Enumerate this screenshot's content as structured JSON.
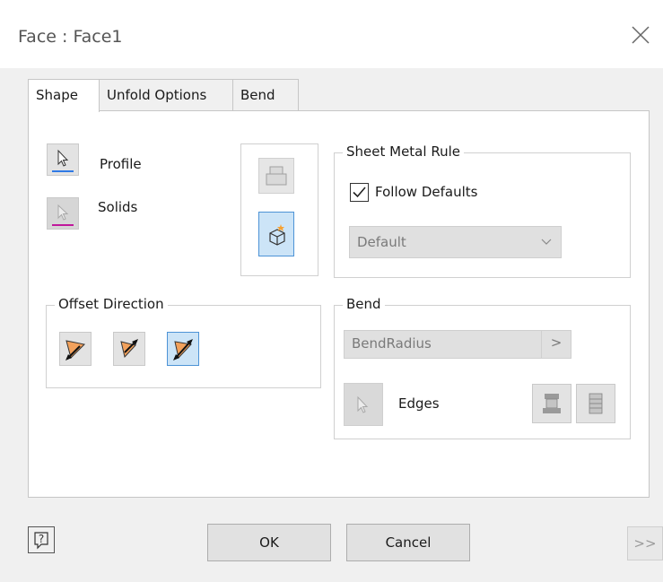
{
  "window": {
    "title": "Face : Face1"
  },
  "tabs": [
    {
      "label": "Shape",
      "active": true
    },
    {
      "label": "Unfold Options",
      "active": false
    },
    {
      "label": "Bend",
      "active": false
    }
  ],
  "shape": {
    "profile_label": "Profile",
    "solids_label": "Solids"
  },
  "sheet_metal_rule": {
    "legend": "Sheet Metal Rule",
    "follow_defaults_label": "Follow Defaults",
    "follow_defaults_checked": true,
    "rule_value": "Default"
  },
  "offset_direction": {
    "legend": "Offset Direction"
  },
  "bend": {
    "legend": "Bend",
    "radius_value": "BendRadius",
    "radius_button": ">",
    "edges_label": "Edges"
  },
  "footer": {
    "ok_label": "OK",
    "cancel_label": "Cancel",
    "more_label": ">>"
  },
  "colors": {
    "profile_underline": "#2f7ae5",
    "solids_underline": "#c0189c",
    "selected_button": "#cce4f7",
    "selected_border": "#4d93d6",
    "arrow_fill": "#f2a15c"
  }
}
